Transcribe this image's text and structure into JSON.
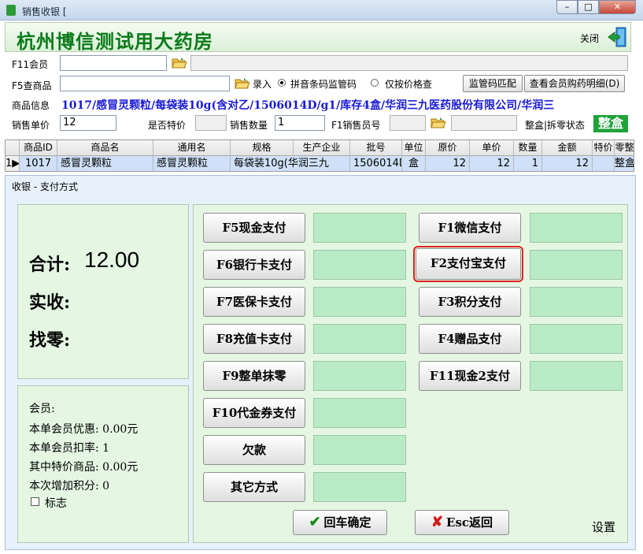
{
  "window": {
    "title": "销售收银 [",
    "minimize": "–",
    "maximize": "□",
    "close": "✕"
  },
  "header": {
    "store_name": "杭州博信测试用大药房",
    "close_label": "关闭"
  },
  "form": {
    "member_label": "F11会员",
    "member_value": "",
    "search_label": "F5查商品",
    "search_value": "",
    "entry_label": "录入",
    "radio_pinyin": "拼音条码监管码",
    "radio_price": "仅按价格查",
    "btn_supervise": "监管码匹配",
    "btn_member_detail": "查看会员购药明细(D)",
    "product_info_label": "商品信息",
    "product_info": "1017/感冒灵颗粒/每袋装10g(含对乙/1506014D/g1/库存4盒/华润三九医药股份有限公司/华润三",
    "unit_price_label": "销售单价",
    "unit_price": "12",
    "special_label": "是否特价",
    "qty_label": "销售数量",
    "qty": "1",
    "seller_label": "F1销售员号",
    "box_status_label": "整盒|拆零状态",
    "box_status": "整盒"
  },
  "table": {
    "columns": [
      "",
      "商品ID",
      "商品名",
      "通用名",
      "规格",
      "生产企业",
      "批号",
      "单位",
      "原价",
      "单价",
      "数量",
      "金额",
      "特价",
      "零整"
    ],
    "rows": [
      [
        "1▶",
        "1017",
        "感冒灵颗粒",
        "感冒灵颗粒",
        "每袋装10g(华润三九",
        "1506014D",
        "盒",
        "12",
        "12",
        "1",
        "12",
        "",
        "整盒"
      ]
    ]
  },
  "dialog": {
    "title": "收银 - 支付方式",
    "total_label": "合计:",
    "total_value": "12.00",
    "received_label": "实收:",
    "change_label": "找零:",
    "member_title": "会员:",
    "member_discount": "本单会员优惠: 0.00元",
    "member_rate": "本单会员扣率: 1",
    "special_goods": "其中特价商品: 0.00元",
    "points": "本次增加积分: 0",
    "flag_label": "标志",
    "pay_left": [
      "F5现金支付",
      "F6银行卡支付",
      "F7医保卡支付",
      "F8充值卡支付",
      "F9整单抹零",
      "F10代金券支付",
      "欠款",
      "其它方式"
    ],
    "pay_right": [
      "F1微信支付",
      "F2支付宝支付",
      "F3积分支付",
      "F4赠品支付",
      "F11现金2支付"
    ],
    "confirm": "回车确定",
    "back": "Esc返回",
    "settings": "设置"
  }
}
